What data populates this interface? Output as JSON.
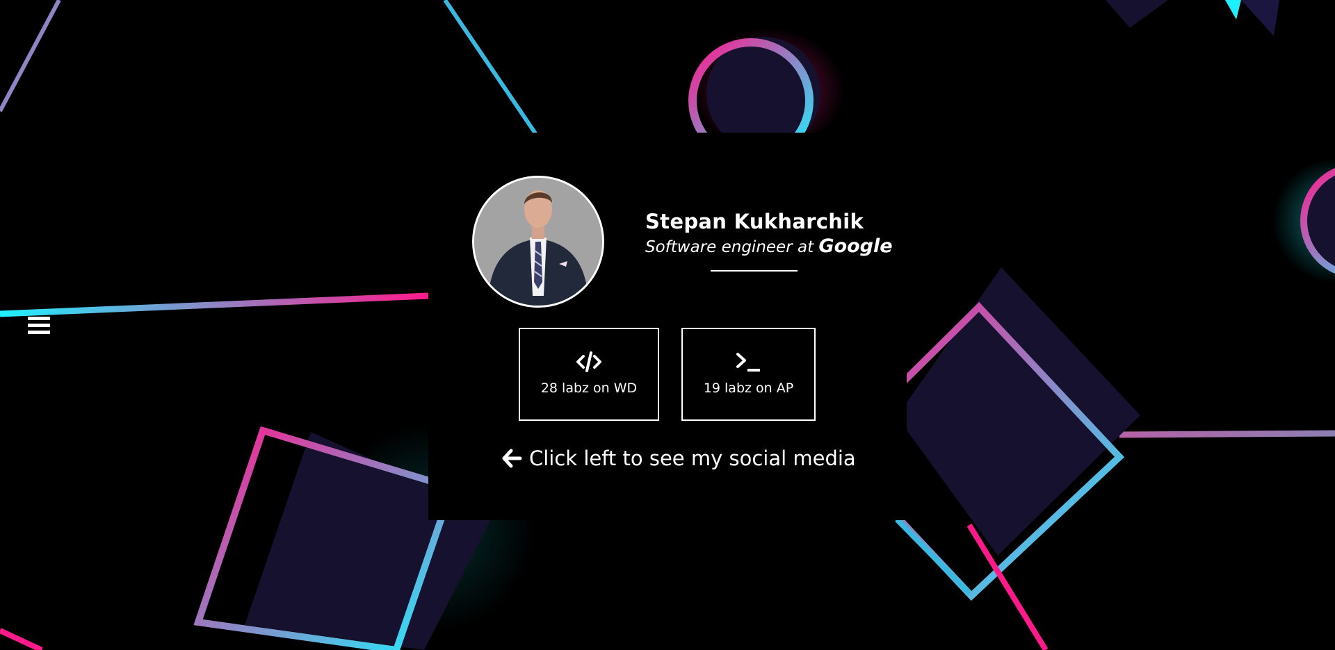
{
  "profile": {
    "name": "Stepan Kukharchik",
    "role_prefix": "Software engineer at",
    "company": "Google"
  },
  "stats": [
    {
      "icon": "code-icon",
      "label": "28 labz on WD"
    },
    {
      "icon": "terminal-icon",
      "label": "19 labz on AP"
    }
  ],
  "hint": {
    "icon": "arrow-left-icon",
    "text": "Click left to see my social media"
  },
  "menu": {
    "icon": "hamburger-icon"
  },
  "colors": {
    "background": "#000000",
    "pink": "#ff1a8c",
    "cyan": "#1ff0ff",
    "navy": "#15112e",
    "text": "#ffffff"
  }
}
